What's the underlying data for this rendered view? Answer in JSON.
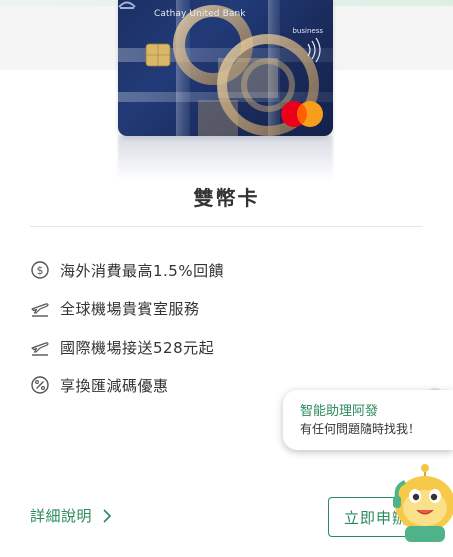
{
  "card": {
    "bank_name": "Cathay United Bank",
    "card_tier": "business",
    "network": "mastercard-logo"
  },
  "product": {
    "name": "雙幣卡"
  },
  "features": [
    {
      "icon": "dollar-circle-icon",
      "text": "海外消費最高1.5%回饋"
    },
    {
      "icon": "airplane-icon",
      "text": "全球機場貴賓室服務"
    },
    {
      "icon": "airplane-icon",
      "text": "國際機場接送528元起"
    },
    {
      "icon": "percent-circle-icon",
      "text": "享換匯減碼優惠"
    }
  ],
  "actions": {
    "detail_label": "詳細說明",
    "apply_label": "立即申辦"
  },
  "assistant": {
    "title": "智能助理阿發",
    "subtitle": "有任何問題隨時找我！"
  },
  "colors": {
    "brand_green": "#2a8a5b",
    "card_navy": "#1b2f63",
    "text": "#333333"
  }
}
